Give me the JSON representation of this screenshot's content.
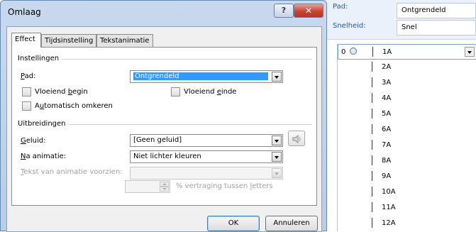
{
  "background_panel": {
    "path_label": "Pad:",
    "path_value": "Ontgrendeld",
    "speed_label": "Snelheid:",
    "speed_value": "Snel",
    "animation_list": [
      {
        "order": "0",
        "label": "1A",
        "selected": true
      },
      {
        "label": "2A"
      },
      {
        "label": "3A"
      },
      {
        "label": "4A"
      },
      {
        "label": "5A"
      },
      {
        "label": "6A"
      },
      {
        "label": "7A"
      },
      {
        "label": "8A"
      },
      {
        "label": "9A"
      },
      {
        "label": "10A"
      },
      {
        "label": "11A"
      },
      {
        "label": "12A"
      }
    ]
  },
  "dialog": {
    "title": "Omlaag",
    "help_glyph": "?",
    "close_glyph": "✕",
    "tabs": [
      {
        "label": "Effect",
        "active": true
      },
      {
        "label": "Tijdsinstelling"
      },
      {
        "label": "Tekstanimatie"
      }
    ],
    "settings": {
      "group_label": "Instellingen",
      "path_label_u": "P",
      "path_label_rest": "ad:",
      "path_value": "Ontgrendeld",
      "smooth_start_pre": "Vloeiend ",
      "smooth_start_u": "b",
      "smooth_start_post": "egin",
      "smooth_end_pre": "Vloeiend ",
      "smooth_end_u": "e",
      "smooth_end_post": "inde",
      "auto_reverse_pre": "A",
      "auto_reverse_u": "u",
      "auto_reverse_post": "tomatisch omkeren"
    },
    "enhancements": {
      "group_label": "Uitbreidingen",
      "sound_label_u": "G",
      "sound_label_rest": "eluid:",
      "sound_value": "[Geen geluid]",
      "after_anim_label_u": "N",
      "after_anim_label_rest": "a animatie:",
      "after_anim_value": "Niet lichter kleuren",
      "animate_text_label_u": "T",
      "animate_text_label_rest": "ekst van animatie voorzien:",
      "animate_text_value": "",
      "delay_value": "",
      "delay_label_pre": "% vertraging tussen ",
      "delay_label_u": "l",
      "delay_label_post": "etters"
    },
    "ok_label": "OK",
    "cancel_label": "Annuleren"
  },
  "colors": {
    "title_bar": "#c8d9ee",
    "close_button": "#c9442f",
    "selection": "#3399ff",
    "accent_label": "#2b579a"
  },
  "icons": [
    "help-icon",
    "close-icon",
    "speaker-icon",
    "clock-icon",
    "chevron-down-icon"
  ]
}
